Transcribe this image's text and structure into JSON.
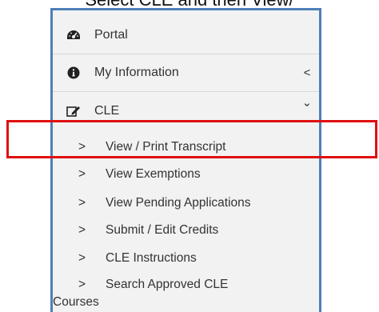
{
  "caption": {
    "text": "Select CLE and then View/"
  },
  "sidebar": {
    "items": [
      {
        "label": "Portal",
        "icon": "dashboard-icon",
        "chevron": ""
      },
      {
        "label": "My Information",
        "icon": "info-circle-icon",
        "chevron": "<"
      },
      {
        "label": "CLE",
        "icon": "edit-icon",
        "chevron": "ˇ"
      }
    ],
    "cle_submenu": [
      {
        "caret": ">",
        "label": "View / Print Transcript"
      },
      {
        "caret": ">",
        "label": "View Exemptions"
      },
      {
        "caret": ">",
        "label": "View Pending Applications"
      },
      {
        "caret": ">",
        "label": "Submit / Edit Credits"
      },
      {
        "caret": ">",
        "label": "CLE Instructions"
      },
      {
        "caret": ">",
        "label": "Search Approved CLE",
        "label_line2": "Courses"
      }
    ]
  },
  "colors": {
    "sidebar_border": "#4d7fb8",
    "sidebar_bg": "#f2f2f2",
    "highlight": "#e01010",
    "text": "#333333"
  }
}
